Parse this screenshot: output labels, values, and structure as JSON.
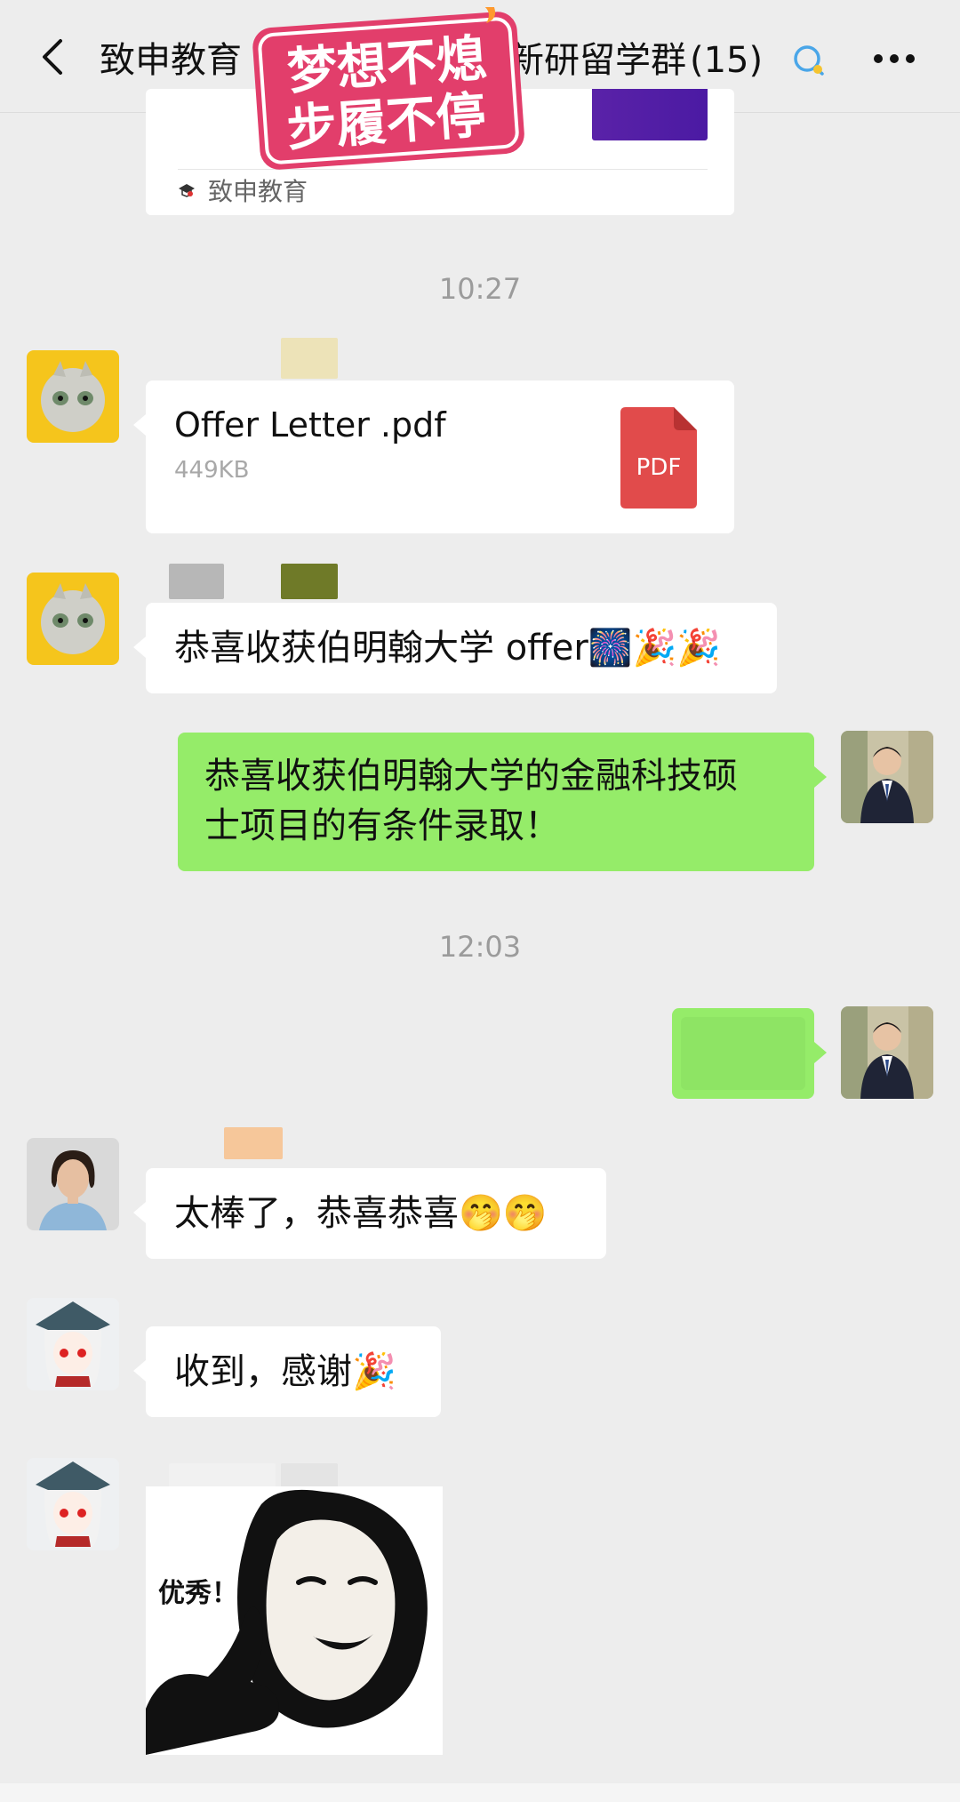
{
  "header": {
    "title_left": "致申教育",
    "title_right": "新研留学群",
    "member_count": "(15)"
  },
  "sticker": {
    "line1": "梦想不熄",
    "line2": "步履不停"
  },
  "card": {
    "source": "致申教育"
  },
  "timestamps": [
    "10:27",
    "12:03"
  ],
  "messages": {
    "file": {
      "name": "Offer Letter .pdf",
      "size": "449KB",
      "badge": "PDF"
    },
    "congrats_received": "恭喜收获伯明翰大学 offer",
    "congrats_sent_line1": "恭喜收获伯明翰大学的金融科技硕",
    "congrats_sent_line2": "士项目的有条件录取！",
    "praise": "太棒了，恭喜恭喜",
    "thanks": "收到，感谢",
    "meme_caption": "优秀！"
  },
  "colors": {
    "background": "#ededed",
    "bubble_white": "#ffffff",
    "bubble_green": "#95ec69",
    "pdf_red": "#e14b4b",
    "sticker_pink": "#e23e6b"
  }
}
